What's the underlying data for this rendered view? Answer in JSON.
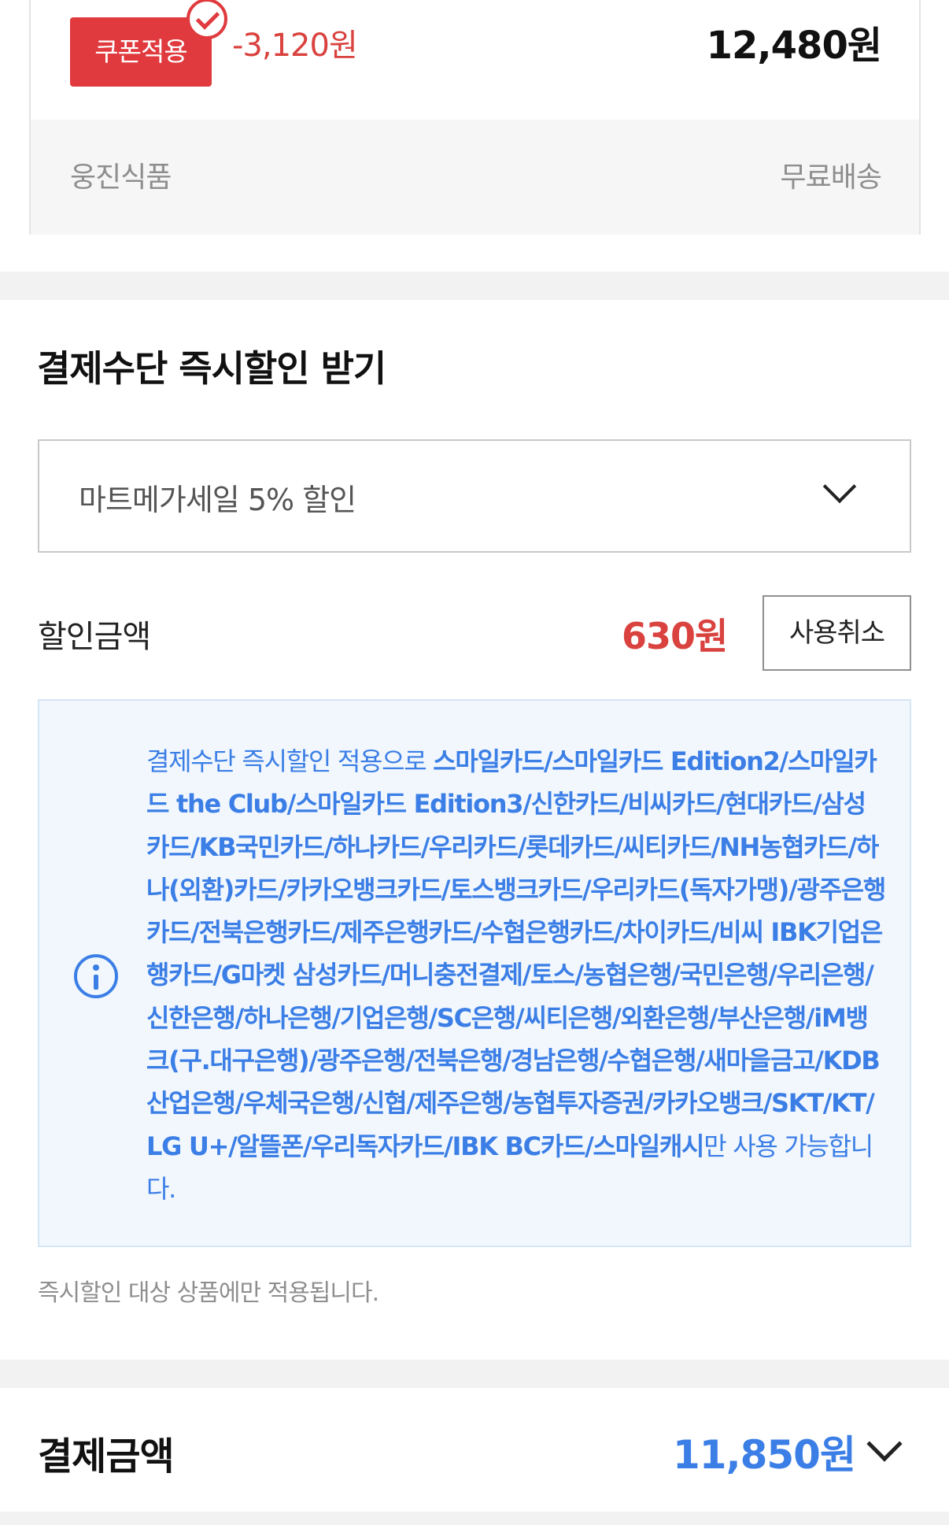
{
  "product": {
    "coupon_label": "쿠폰적용",
    "coupon_discount": "-3,120원",
    "final_price": "12,480원",
    "seller": "웅진식품",
    "shipping": "무료배송"
  },
  "instant_discount": {
    "title": "결제수단 즉시할인 받기",
    "selected_option": "마트메가세일 5% 할인",
    "amount_label": "할인금액",
    "amount": "630원",
    "cancel_button": "사용취소",
    "info_prefix": "결제수단 즉시할인 적용으로 ",
    "info_methods": "스마일카드/스마일카드 Edition2/스마일카드 the Club/스마일카드 Edition3/신한카드/비씨카드/현대카드/삼성카드/KB국민카드/하나카드/우리카드/롯데카드/씨티카드/NH농협카드/하나(외환)카드/카카오뱅크카드/토스뱅크카드/우리카드(독자가맹)/광주은행카드/전북은행카드/제주은행카드/수협은행카드/차이카드/비씨 IBK기업은행카드/G마켓 삼성카드/머니충전결제/토스/농협은행/국민은행/우리은행/신한은행/하나은행/기업은행/SC은행/씨티은행/외환은행/부산은행/iM뱅크(구.대구은행)/광주은행/전북은행/경남은행/수협은행/새마을금고/KDB산업은행/우체국은행/신협/제주은행/농협투자증권/카카오뱅크/SKT/KT/LG U+/알뜰폰/우리독자카드/IBK BC카드/스마일캐시",
    "info_suffix": "만 사용 가능합니다.",
    "footnote": "즉시할인 대상 상품에만 적용됩니다."
  },
  "payment": {
    "label": "결제금액",
    "total": "11,850원"
  },
  "colors": {
    "accent_red": "#e03a3e",
    "accent_blue": "#3b7ee6",
    "info_bg": "#f1f7fd"
  },
  "icons": [
    "check-circle-icon",
    "chevron-down-icon",
    "info-icon"
  ]
}
